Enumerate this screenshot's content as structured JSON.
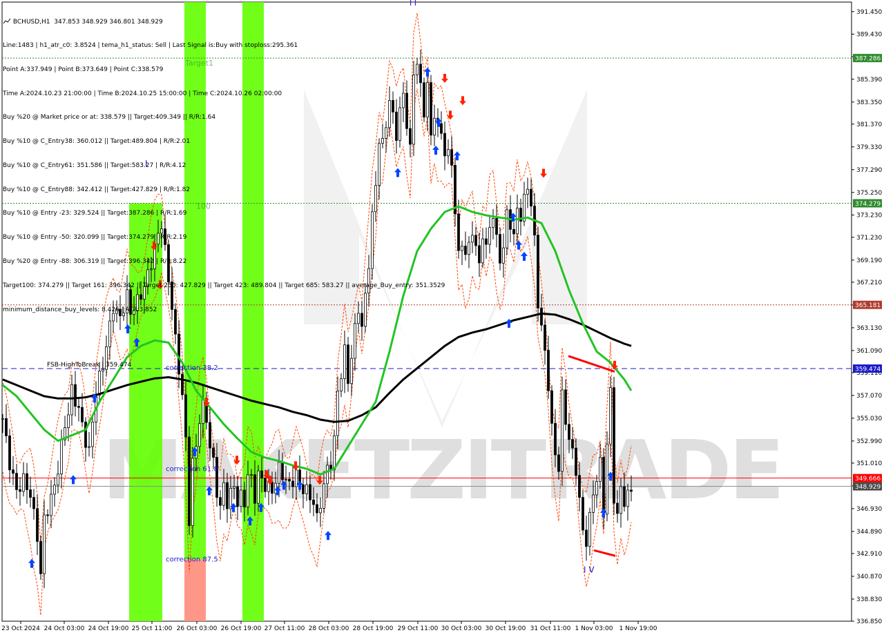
{
  "header": {
    "symbol": "BCHUSD,H1",
    "ohlc": "347.853 348.929 346.801 348.929"
  },
  "info_lines": [
    "Line:1483 | h1_atr_c0: 3.8524 | tema_h1_status: Sell | Last Signal is:Buy with stoploss:295.361",
    "Point A:337.949 | Point B:373.649 | Point C:338.579",
    "Time A:2024.10.23 21:00:00 | Time B:2024.10.25 15:00:00 | Time C:2024.10.26 02:00:00",
    "Buy %20 @ Market price or at: 338.579 || Target:409.349 || R/R:1.64",
    "Buy %10 @ C_Entry38: 360.012 || Target:489.804 | R/R:2.01",
    "Buy %10 @ C_Entry61: 351.586 || Target:583.27 | R/R:4.12",
    "Buy %10 @ C_Entry88: 342.412 || Target:427.829 | R/R:1.82",
    "Buy %10 @ Entry -23: 329.524 || Target:387.286 | R/R:1.69",
    "Buy %10 @ Entry -50: 320.099 || Target:374.279 | R/R:2.19",
    "Buy %20 @ Entry -88: 306.319 || Target:396.342 | R/R:8.22",
    "Target100: 374.279 || Target 161: 396.342 || Target 250: 427.829 || Target 423: 489.804 || Target 685: 583.27 || average_Buy_entry: 351.3529",
    "minimum_distance_buy_levels: 8.426 | ATR:3.852"
  ],
  "colors": {
    "background": "#ffffff",
    "bull_candle": "#000000",
    "bear_candle": "#000000",
    "ma_fast": "#22c422",
    "ma_slow": "#000000",
    "channel": "#ff4500",
    "zone_green": "#62ff00",
    "zone_red": "#ff8c7c",
    "target_line": "#2e8b2e",
    "stop_line": "#b03a2e",
    "fsb_line": "#1a1acc",
    "price_line": "#ff0000",
    "buy_arrow": "#0044ff",
    "sell_arrow": "#ff2200"
  },
  "watermark": "MAKETZITRADE",
  "chart_data": {
    "type": "candlestick",
    "title": "BCHUSD,H1",
    "ylim": [
      336.85,
      392.3
    ],
    "y_ticks": [
      "391.450",
      "389.430",
      "387.410",
      "385.390",
      "383.350",
      "381.370",
      "379.330",
      "377.290",
      "375.250",
      "373.230",
      "371.230",
      "369.190",
      "367.210",
      "365.170",
      "363.130",
      "361.090",
      "359.110",
      "357.070",
      "355.030",
      "352.990",
      "351.010",
      "348.970",
      "346.930",
      "344.890",
      "342.910",
      "340.870",
      "338.830",
      "336.850"
    ],
    "x_ticks": [
      "23 Oct 2024",
      "24 Oct 03:00",
      "24 Oct 19:00",
      "25 Oct 11:00",
      "26 Oct 03:00",
      "26 Oct 19:00",
      "27 Oct 11:00",
      "28 Oct 03:00",
      "28 Oct 19:00",
      "29 Oct 11:00",
      "30 Oct 03:00",
      "30 Oct 19:00",
      "31 Oct 11:00",
      "1 Nov 03:00",
      "1 Nov 19:00"
    ],
    "close_path": [
      [
        0,
        355.0
      ],
      [
        2,
        351.0
      ],
      [
        4,
        348.5
      ],
      [
        6,
        349.5
      ],
      [
        8,
        348.2
      ],
      [
        10,
        344.5
      ],
      [
        11,
        341.0
      ],
      [
        12,
        346.0
      ],
      [
        14,
        347.8
      ],
      [
        15,
        349.0
      ],
      [
        16,
        350.5
      ],
      [
        18,
        354.5
      ],
      [
        19,
        355.5
      ],
      [
        20,
        357.5
      ],
      [
        22,
        355.8
      ],
      [
        24,
        353.0
      ],
      [
        25,
        352.0
      ],
      [
        27,
        357.5
      ],
      [
        29,
        359.8
      ],
      [
        30,
        361.5
      ],
      [
        32,
        365.0
      ],
      [
        34,
        364.0
      ],
      [
        36,
        366.0
      ],
      [
        37,
        364.5
      ],
      [
        39,
        365.5
      ],
      [
        41,
        366.8
      ],
      [
        43,
        369.0
      ],
      [
        45,
        371.5
      ],
      [
        46,
        372.5
      ],
      [
        47,
        370.0
      ],
      [
        49,
        365.0
      ],
      [
        50,
        362.0
      ],
      [
        52,
        357.0
      ],
      [
        53,
        353.0
      ],
      [
        54,
        346.0
      ],
      [
        55,
        351.0
      ],
      [
        56,
        352.5
      ],
      [
        57,
        355.0
      ],
      [
        58,
        356.2
      ],
      [
        59,
        355.0
      ],
      [
        60,
        352.5
      ],
      [
        61,
        351.0
      ],
      [
        62,
        348.5
      ],
      [
        63,
        347.0
      ],
      [
        64,
        349.0
      ],
      [
        65,
        347.5
      ],
      [
        67,
        349.0
      ],
      [
        68,
        347.5
      ],
      [
        69,
        348.0
      ],
      [
        70,
        347.5
      ],
      [
        71,
        350.0
      ],
      [
        72,
        349.5
      ],
      [
        73,
        348.0
      ],
      [
        74,
        350.0
      ],
      [
        75,
        349.5
      ],
      [
        76,
        349.0
      ],
      [
        78,
        348.5
      ],
      [
        80,
        350.5
      ],
      [
        81,
        350.0
      ],
      [
        83,
        349.0
      ],
      [
        85,
        350.0
      ],
      [
        86,
        349.0
      ],
      [
        88,
        348.5
      ],
      [
        90,
        347.5
      ],
      [
        91,
        346.0
      ],
      [
        92,
        347.5
      ],
      [
        93,
        349.0
      ],
      [
        94,
        350.5
      ],
      [
        95,
        351.0
      ],
      [
        96,
        353.0
      ],
      [
        97,
        357.5
      ],
      [
        98,
        359.0
      ],
      [
        99,
        361.0
      ],
      [
        100,
        358.5
      ],
      [
        101,
        360.5
      ],
      [
        102,
        363.0
      ],
      [
        103,
        365.0
      ],
      [
        104,
        363.0
      ],
      [
        105,
        366.0
      ],
      [
        106,
        369.0
      ],
      [
        107,
        373.0
      ],
      [
        108,
        376.0
      ],
      [
        109,
        380.0
      ],
      [
        110,
        379.5
      ],
      [
        111,
        381.5
      ],
      [
        112,
        383.5
      ],
      [
        113,
        382.0
      ],
      [
        114,
        380.5
      ],
      [
        115,
        382.5
      ],
      [
        116,
        384.0
      ],
      [
        117,
        381.5
      ],
      [
        118,
        379.0
      ],
      [
        119,
        386.0
      ],
      [
        120,
        387.0
      ],
      [
        121,
        384.5
      ],
      [
        122,
        382.5
      ],
      [
        123,
        385.0
      ],
      [
        124,
        380.0
      ],
      [
        125,
        382.5
      ],
      [
        126,
        381.0
      ],
      [
        127,
        380.5
      ],
      [
        128,
        379.0
      ],
      [
        129,
        378.5
      ],
      [
        130,
        378.0
      ],
      [
        131,
        373.5
      ],
      [
        132,
        369.5
      ],
      [
        133,
        371.0
      ],
      [
        134,
        369.5
      ],
      [
        135,
        370.5
      ],
      [
        136,
        372.0
      ],
      [
        137,
        370.0
      ],
      [
        138,
        369.0
      ],
      [
        139,
        371.5
      ],
      [
        140,
        370.0
      ],
      [
        141,
        372.5
      ],
      [
        142,
        373.0
      ],
      [
        143,
        371.0
      ],
      [
        144,
        369.5
      ],
      [
        145,
        370.0
      ],
      [
        146,
        373.5
      ],
      [
        147,
        372.5
      ],
      [
        148,
        371.0
      ],
      [
        149,
        374.0
      ],
      [
        150,
        373.0
      ],
      [
        151,
        374.5
      ],
      [
        152,
        376.0
      ],
      [
        153,
        374.0
      ],
      [
        154,
        371.0
      ],
      [
        155,
        365.5
      ],
      [
        156,
        363.0
      ],
      [
        157,
        361.0
      ],
      [
        158,
        358.0
      ],
      [
        159,
        354.0
      ],
      [
        160,
        352.0
      ],
      [
        161,
        350.5
      ],
      [
        162,
        357.0
      ],
      [
        163,
        355.0
      ],
      [
        164,
        353.0
      ],
      [
        165,
        352.0
      ],
      [
        166,
        350.5
      ],
      [
        167,
        347.5
      ],
      [
        168,
        345.0
      ],
      [
        169,
        344.0
      ],
      [
        170,
        346.0
      ],
      [
        171,
        348.5
      ],
      [
        172,
        349.5
      ],
      [
        173,
        351.0
      ],
      [
        174,
        347.0
      ],
      [
        175,
        352.5
      ],
      [
        176,
        357.5
      ],
      [
        177,
        348.0
      ],
      [
        178,
        346.0
      ],
      [
        179,
        349.0
      ],
      [
        180,
        347.5
      ],
      [
        181,
        348.0
      ],
      [
        182,
        348.9
      ]
    ],
    "ma_fast": [
      [
        0,
        358.0
      ],
      [
        4,
        357.0
      ],
      [
        8,
        355.5
      ],
      [
        12,
        354.0
      ],
      [
        16,
        353.0
      ],
      [
        20,
        353.5
      ],
      [
        24,
        354.0
      ],
      [
        28,
        356.5
      ],
      [
        32,
        358.5
      ],
      [
        36,
        360.5
      ],
      [
        40,
        361.5
      ],
      [
        44,
        362.0
      ],
      [
        48,
        361.8
      ],
      [
        52,
        360.0
      ],
      [
        56,
        357.5
      ],
      [
        60,
        356.0
      ],
      [
        64,
        354.5
      ],
      [
        68,
        353.2
      ],
      [
        72,
        352.0
      ],
      [
        76,
        351.5
      ],
      [
        80,
        351.2
      ],
      [
        84,
        350.8
      ],
      [
        88,
        350.5
      ],
      [
        92,
        350.0
      ],
      [
        96,
        350.5
      ],
      [
        100,
        352.5
      ],
      [
        104,
        354.5
      ],
      [
        108,
        356.5
      ],
      [
        112,
        361.0
      ],
      [
        116,
        366.0
      ],
      [
        120,
        370.0
      ],
      [
        124,
        372.0
      ],
      [
        128,
        373.5
      ],
      [
        132,
        374.0
      ],
      [
        136,
        373.5
      ],
      [
        140,
        373.2
      ],
      [
        144,
        373.0
      ],
      [
        148,
        372.8
      ],
      [
        152,
        373.0
      ],
      [
        156,
        372.5
      ],
      [
        160,
        370.0
      ],
      [
        164,
        366.5
      ],
      [
        168,
        363.5
      ],
      [
        172,
        361.0
      ],
      [
        176,
        360.0
      ],
      [
        180,
        358.5
      ],
      [
        182,
        357.5
      ]
    ],
    "ma_slow": [
      [
        0,
        358.5
      ],
      [
        4,
        358.0
      ],
      [
        8,
        357.5
      ],
      [
        12,
        357.0
      ],
      [
        16,
        356.8
      ],
      [
        20,
        356.8
      ],
      [
        24,
        356.9
      ],
      [
        28,
        357.2
      ],
      [
        32,
        357.6
      ],
      [
        36,
        358.0
      ],
      [
        40,
        358.3
      ],
      [
        44,
        358.6
      ],
      [
        48,
        358.7
      ],
      [
        52,
        358.5
      ],
      [
        56,
        358.2
      ],
      [
        60,
        357.8
      ],
      [
        64,
        357.4
      ],
      [
        68,
        357.0
      ],
      [
        72,
        356.6
      ],
      [
        76,
        356.3
      ],
      [
        80,
        356.0
      ],
      [
        84,
        355.6
      ],
      [
        88,
        355.3
      ],
      [
        92,
        354.9
      ],
      [
        96,
        354.7
      ],
      [
        100,
        354.8
      ],
      [
        104,
        355.3
      ],
      [
        108,
        356.0
      ],
      [
        112,
        357.3
      ],
      [
        116,
        358.5
      ],
      [
        120,
        359.5
      ],
      [
        124,
        360.5
      ],
      [
        128,
        361.5
      ],
      [
        132,
        362.3
      ],
      [
        136,
        362.7
      ],
      [
        140,
        363.0
      ],
      [
        144,
        363.4
      ],
      [
        148,
        363.8
      ],
      [
        152,
        364.1
      ],
      [
        156,
        364.4
      ],
      [
        160,
        364.3
      ],
      [
        164,
        363.9
      ],
      [
        168,
        363.4
      ],
      [
        172,
        362.8
      ],
      [
        176,
        362.2
      ],
      [
        180,
        361.7
      ],
      [
        182,
        361.5
      ]
    ],
    "series": [
      {
        "values": [
          374.279
        ]
      },
      {
        "values": [
          387.286
        ]
      },
      {
        "values": [
          365.181
        ]
      },
      {
        "values": [
          359.474
        ]
      },
      {
        "values": [
          349.666
        ]
      },
      {
        "values": [
          348.929
        ]
      }
    ],
    "right_labels": [
      {
        "text": "387.286",
        "y": 387.286,
        "color": "#2e8b2e"
      },
      {
        "text": "374.279",
        "y": 374.279,
        "color": "#2e8b2e"
      },
      {
        "text": "365.181",
        "y": 365.181,
        "color": "#b03a2e"
      },
      {
        "text": "359.474",
        "y": 359.474,
        "color": "#1a1acc"
      },
      {
        "text": "349.666",
        "y": 349.666,
        "color": "#ff0000"
      },
      {
        "text": "348.929",
        "y": 348.929,
        "color": "#4a4a4a"
      }
    ],
    "annotations": [
      {
        "text": "FSB-HighToBreak | 359.474",
        "color": "#000000"
      },
      {
        "text": "correction 38.2",
        "color": "#1a1acc"
      },
      {
        "text": "correction 61.8",
        "color": "#1a1acc"
      },
      {
        "text": "correction 87.5",
        "color": "#1a1acc"
      },
      {
        "text": "100",
        "color": "#2e8b2e"
      },
      {
        "text": "Target1",
        "color": "#2e8b2e"
      },
      {
        "text": "I",
        "color": "#1a1acc"
      },
      {
        "text": "I V",
        "color": "#1a1acc"
      },
      {
        "text": "I I",
        "color": "#1a1acc"
      }
    ],
    "grid": false
  }
}
